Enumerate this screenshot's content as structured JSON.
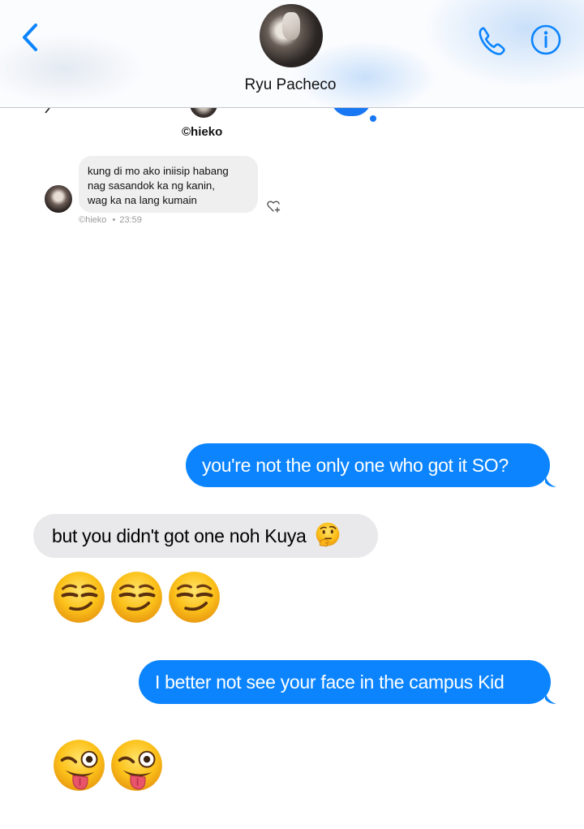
{
  "header": {
    "contact_name": "Ryu Pacheco",
    "accent_color": "#0b84fe",
    "back_icon": "chevron-left-icon",
    "call_icon": "phone-icon",
    "info_icon": "info-icon"
  },
  "shared_image": {
    "watermark_top": "©hieko",
    "tweet": {
      "lines": [
        "kung di mo ako iniisip habang",
        "nag sasandok ka ng kanin,",
        "wag ka na lang kumain"
      ],
      "author": "©hieko",
      "separator": "•",
      "time": "23:59",
      "react_icon": "heart-plus-icon"
    }
  },
  "messages": [
    {
      "direction": "sent",
      "text": "you're not the only one who got it SO?"
    },
    {
      "direction": "received",
      "text": "but you didn't got one noh Kuya",
      "emoji": "thinking-face"
    },
    {
      "direction": "received",
      "emoji_only": [
        "smirking-face",
        "smirking-face",
        "smirking-face"
      ]
    },
    {
      "direction": "sent",
      "text": "I better not see your face in the campus Kid"
    },
    {
      "direction": "received",
      "emoji_only": [
        "winking-face-with-tongue",
        "winking-face-with-tongue"
      ]
    }
  ],
  "colors": {
    "sent_bubble": "#0b84fe",
    "received_bubble": "#e9e9eb",
    "header_border": "#c7c7cc"
  }
}
